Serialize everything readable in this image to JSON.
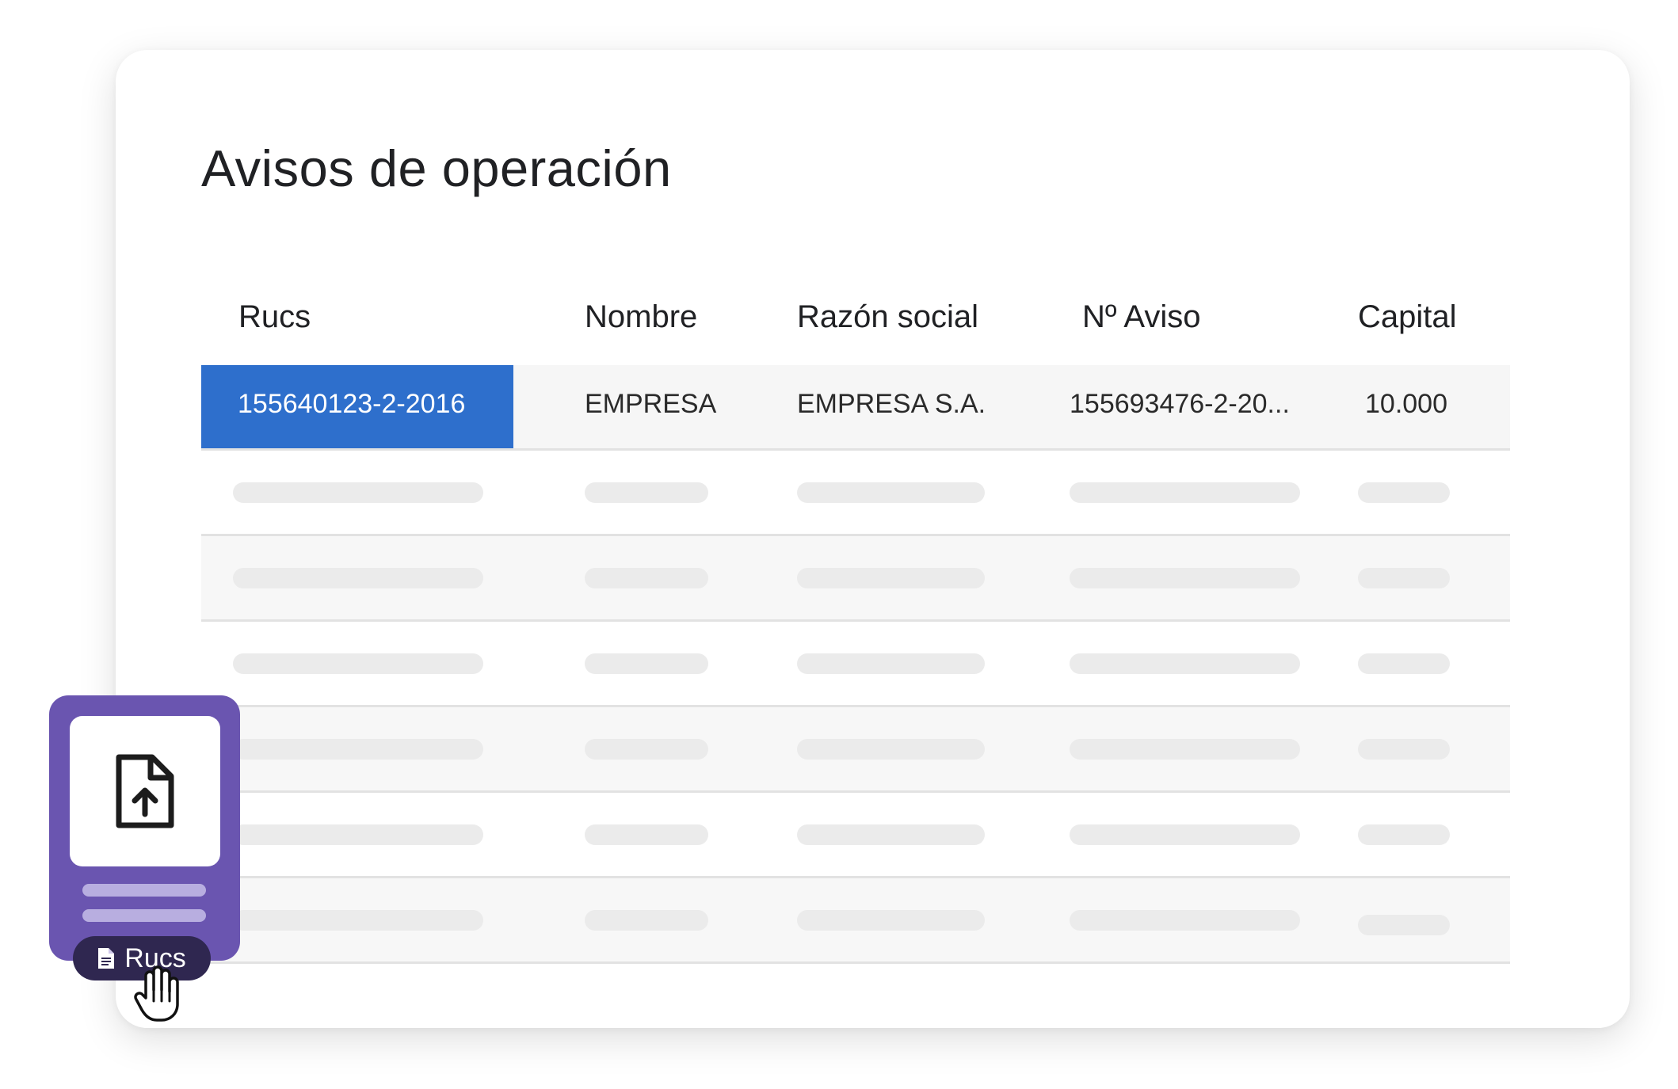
{
  "panel": {
    "title": "Avisos de operación"
  },
  "table": {
    "columns": [
      "Rucs",
      "Nombre",
      "Razón social",
      "Nº Aviso",
      "Capital"
    ],
    "rows": [
      {
        "ruc": "155640123-2-2016",
        "nombre": "EMPRESA",
        "razon_social": "EMPRESA S.A.",
        "aviso": "155693476-2-20...",
        "capital": "10.000",
        "selected_cell": "ruc"
      }
    ],
    "placeholder_rows": 6,
    "colors": {
      "selected_cell_bg": "#2e6fcc",
      "placeholder_bar": "#ebebeb",
      "row_divider": "#e2e2e2"
    }
  },
  "upload_widget": {
    "icon": "file-upload-icon",
    "chip_icon": "document-icon",
    "chip_label": "Rucs",
    "cursor": "hand-pointer-icon",
    "colors": {
      "widget_bg": "#6a55b0",
      "chip_bg": "#2f2750"
    }
  }
}
